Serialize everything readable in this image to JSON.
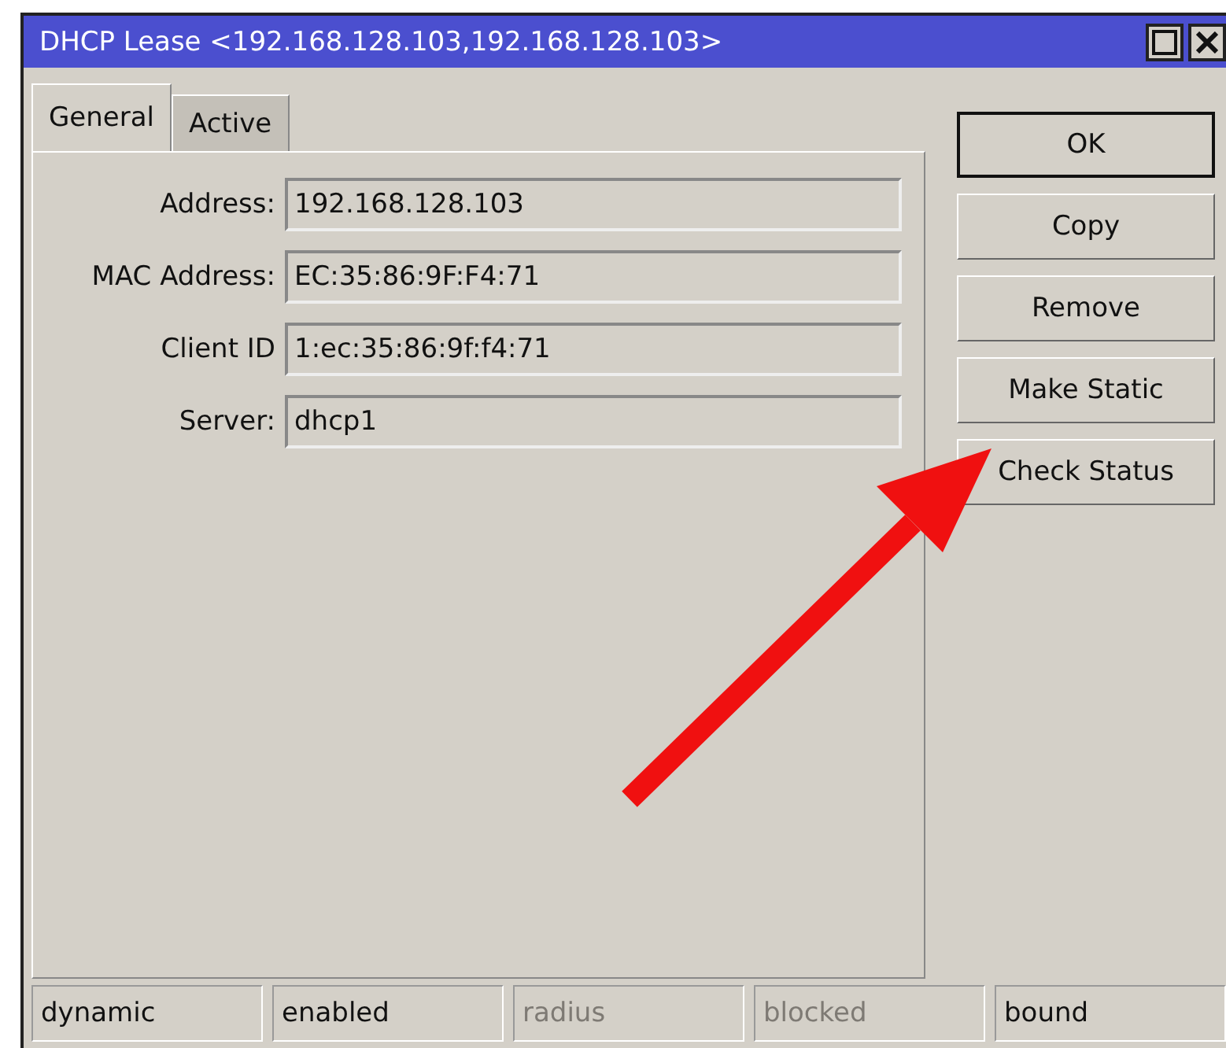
{
  "window": {
    "title": "DHCP Lease <192.168.128.103,192.168.128.103>"
  },
  "tabs": [
    {
      "label": "General",
      "selected": true
    },
    {
      "label": "Active",
      "selected": false
    }
  ],
  "fields": [
    {
      "label": "Address:",
      "value": "192.168.128.103"
    },
    {
      "label": "MAC Address:",
      "value": "EC:35:86:9F:F4:71"
    },
    {
      "label": "Client ID",
      "value": "1:ec:35:86:9f:f4:71"
    },
    {
      "label": "Server:",
      "value": "dhcp1"
    }
  ],
  "buttons": [
    {
      "label": "OK",
      "selected": true
    },
    {
      "label": "Copy",
      "selected": false
    },
    {
      "label": "Remove",
      "selected": false
    },
    {
      "label": "Make Static",
      "selected": false
    },
    {
      "label": "Check Status",
      "selected": false
    }
  ],
  "status_bar": [
    {
      "text": "dynamic",
      "disabled": false
    },
    {
      "text": "enabled",
      "disabled": false
    },
    {
      "text": "radius",
      "disabled": true
    },
    {
      "text": "blocked",
      "disabled": true
    },
    {
      "text": "bound",
      "disabled": false
    }
  ]
}
